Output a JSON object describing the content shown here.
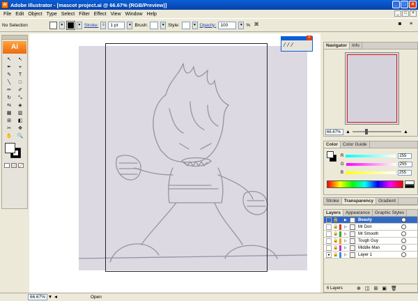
{
  "window": {
    "title": "Adobe Illustrator - [mascot project.ai @ 66.67% (RGB/Preview)]",
    "app_icon": "Ai",
    "minimize": "_",
    "maximize": "□",
    "close": "×"
  },
  "menu": {
    "items": [
      "File",
      "Edit",
      "Object",
      "Type",
      "Select",
      "Filter",
      "Effect",
      "View",
      "Window",
      "Help"
    ],
    "doc_min": "_",
    "doc_restore": "□",
    "doc_close": "×"
  },
  "control": {
    "selection": "No Selection",
    "stroke_label": "Stroke:",
    "stroke_value": "1 pt",
    "brush_label": "Brush:",
    "style_label": "Style:",
    "opacity_label": "Opacity:",
    "opacity_value": "100",
    "opacity_unit": "%"
  },
  "toolbox": {
    "logo": "Ai",
    "tools": [
      "↖",
      "↖",
      "✒",
      "⌖",
      "✎",
      "T",
      "╲",
      "□",
      "✏",
      "✐",
      "↻",
      "⤡",
      "⇆",
      "◈",
      "▦",
      "▥",
      "⊞",
      "◧",
      "✂",
      "✥",
      "✋",
      "🔍"
    ]
  },
  "float_panel": {
    "close": "×",
    "btns": [
      "⁄",
      "⁄",
      "⁄"
    ]
  },
  "navigator": {
    "tabs": [
      "Navigator",
      "Info"
    ],
    "zoom": "66.67%",
    "zoom_out": "▲",
    "zoom_in": "▲"
  },
  "color": {
    "tabs": [
      "Color",
      "Color Guide"
    ],
    "channels": [
      {
        "label": "R",
        "value": "255",
        "bar": "#e04040"
      },
      {
        "label": "G",
        "value": "255",
        "bar": "#40c040"
      },
      {
        "label": "B",
        "value": "255",
        "bar": "#4060e0"
      }
    ]
  },
  "transparency": {
    "tabs": [
      "Stroke",
      "Transparency",
      "Gradient"
    ]
  },
  "layers": {
    "tabs": [
      "Layers",
      "Appearance",
      "Graphic Styles"
    ],
    "rows": [
      {
        "name": "Beauty",
        "color": "#2a5cd8",
        "selected": true
      },
      {
        "name": "Mr Don",
        "color": "#e03030",
        "selected": false
      },
      {
        "name": "Mr Smooth",
        "color": "#30b030",
        "selected": false
      },
      {
        "name": "Tough Guy",
        "color": "#e8a020",
        "selected": false
      },
      {
        "name": "Middle Man",
        "color": "#c030c0",
        "selected": false
      },
      {
        "name": "Layer 1",
        "color": "#3090e0",
        "selected": false
      }
    ],
    "count": "6 Layers"
  },
  "status": {
    "zoom": "66.67%",
    "mode": "Open"
  }
}
